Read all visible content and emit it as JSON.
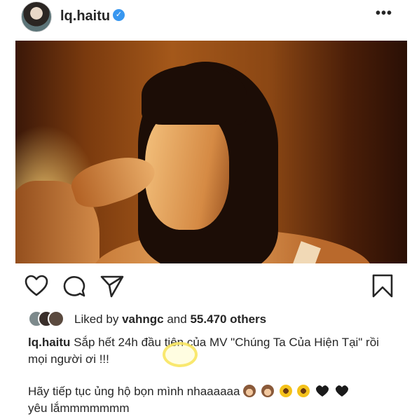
{
  "post": {
    "username": "lq.haitu",
    "verified": "✓",
    "more": "•••"
  },
  "likes": {
    "prefix": "Liked by",
    "user": "vahngc",
    "and": "and",
    "count": "55.470 others"
  },
  "caption": {
    "username": "lq.haitu",
    "line1": "Sắp hết 24h đầu tiên của MV \"Chúng Ta Của Hiện Tại\" rồi mọi người ơi !!!",
    "line2": "Hãy tiếp tục ủng hộ bọn mình nhaaaaaa",
    "line3": "yêu lắmmmmmmm",
    "emojis": [
      "monkey",
      "monkey",
      "sunflower",
      "sunflower",
      "black-heart",
      "black-heart"
    ]
  },
  "colors": {
    "verified": "#3897f0",
    "text": "#262626",
    "highlight": "#f8e45c"
  }
}
